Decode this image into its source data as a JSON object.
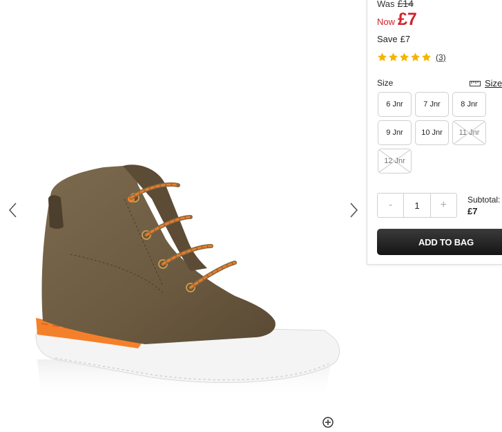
{
  "pricing": {
    "was_label": "Was",
    "was_price": "£14",
    "now_label": "Now",
    "now_price": "£7",
    "save_label": "Save",
    "save_value": "£7"
  },
  "rating": {
    "stars": 5,
    "count_text": "(3)"
  },
  "size": {
    "label": "Size",
    "guide_label": "Size",
    "options": [
      {
        "label": "6 Jnr",
        "available": true
      },
      {
        "label": "7 Jnr",
        "available": true
      },
      {
        "label": "8 Jnr",
        "available": true
      },
      {
        "label": "9 Jnr",
        "available": true
      },
      {
        "label": "10 Jnr",
        "available": true
      },
      {
        "label": "11 Jnr",
        "available": false
      },
      {
        "label": "12 Jnr",
        "available": false
      }
    ]
  },
  "quantity": {
    "minus": "-",
    "value": "1",
    "plus": "+"
  },
  "subtotal": {
    "label": "Subtotal:",
    "value": "£7"
  },
  "actions": {
    "add_to_bag": "ADD TO BAG"
  },
  "icons": {
    "prev": "chevron-left-icon",
    "next": "chevron-right-icon",
    "zoom": "zoom-icon",
    "ruler": "ruler-icon",
    "star": "star-icon"
  },
  "colors": {
    "price_red": "#d1232a",
    "star_gold": "#f5b400",
    "button_dark": "#1f1f1f"
  }
}
